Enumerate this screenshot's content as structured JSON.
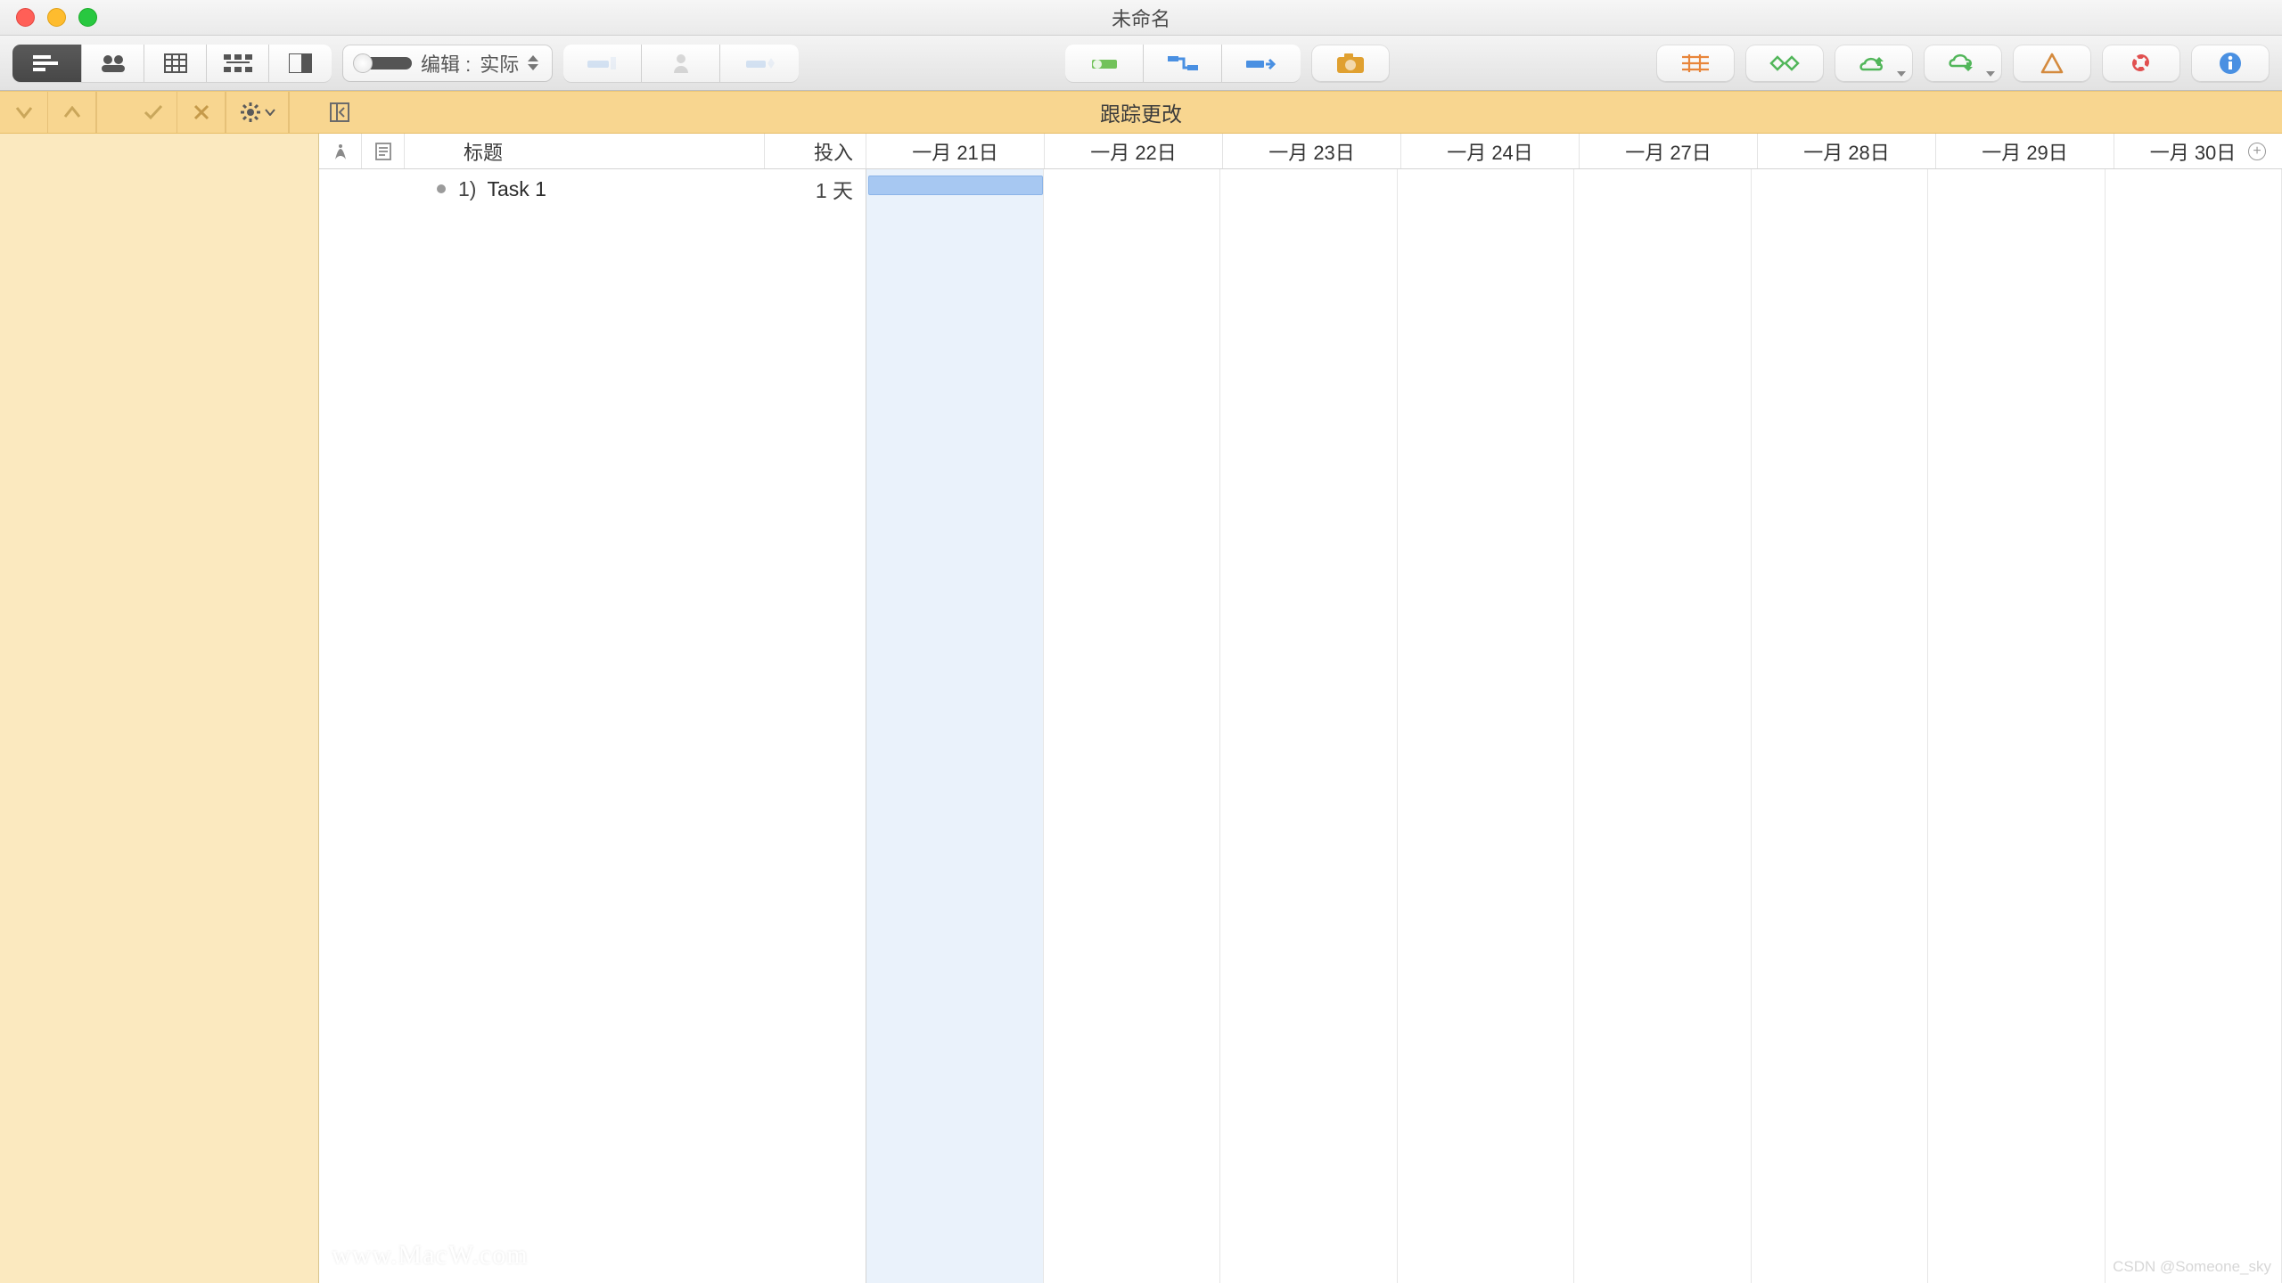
{
  "window": {
    "title": "未命名"
  },
  "toolbar": {
    "edit_prefix": "编辑 :",
    "edit_mode": "实际"
  },
  "subbar": {
    "label": "跟踪更改"
  },
  "columns": {
    "title": "标题",
    "effort": "投入"
  },
  "dates": [
    "一月 21日",
    "一月 22日",
    "一月 23日",
    "一月 24日",
    "一月 27日",
    "一月 28日",
    "一月 29日",
    "一月 30日"
  ],
  "tasks": [
    {
      "index": "1)",
      "title": "Task 1",
      "effort": "1 天",
      "start_col": 0,
      "span_cols": 1
    }
  ],
  "today_col": 0,
  "watermarks": {
    "site": "www.MacW.com",
    "credit": "CSDN @Someone_sky"
  }
}
